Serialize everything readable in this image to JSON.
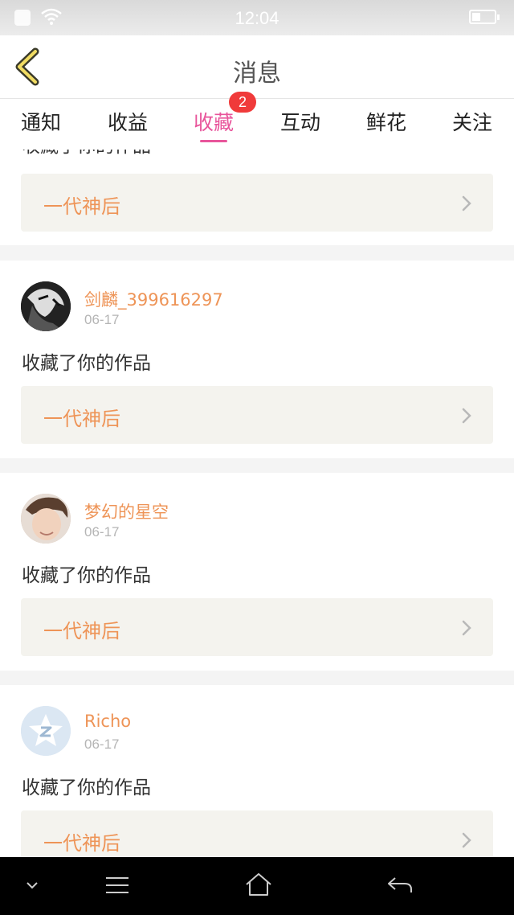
{
  "status_bar": {
    "time": "12:04"
  },
  "header": {
    "title": "消息"
  },
  "tabs": [
    {
      "label": "通知"
    },
    {
      "label": "收益"
    },
    {
      "label": "收藏"
    },
    {
      "label": "互动"
    },
    {
      "label": "鲜花"
    },
    {
      "label": "关注"
    }
  ],
  "active_tab": "收藏",
  "badge": {
    "count": "2"
  },
  "feed": {
    "partial_item": {
      "action": "收藏了你的作品",
      "work_title": "一代神后"
    },
    "items": [
      {
        "username": "剑麟_399616297",
        "date": "06-17",
        "action": "收藏了你的作品",
        "work_title": "一代神后"
      },
      {
        "username": "梦幻的星空",
        "date": "06-17",
        "action": "收藏了你的作品",
        "work_title": "一代神后"
      },
      {
        "username": "Richo",
        "date": "06-17",
        "action": "收藏了你的作品",
        "work_title": "一代神后"
      }
    ]
  },
  "colors": {
    "accent_pink": "#e8559b",
    "accent_orange": "#ee9457",
    "badge_red": "#f03a3a"
  }
}
